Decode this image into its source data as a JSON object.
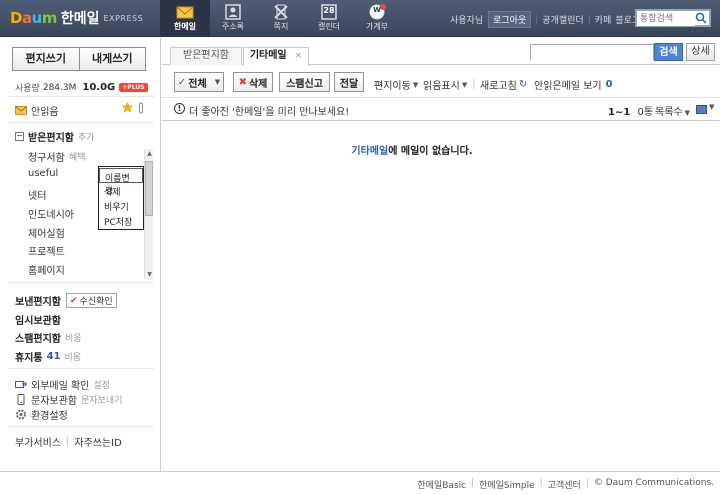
{
  "brand": {
    "logo_letters": [
      "D",
      "a",
      "u",
      "m"
    ],
    "service": "한메일",
    "edition": "EXPRESS"
  },
  "topnav": [
    {
      "label": "한메일",
      "icon": "mail-icon"
    },
    {
      "label": "주소록",
      "icon": "contacts-icon"
    },
    {
      "label": "쪽지",
      "icon": "note-icon"
    },
    {
      "label": "캘린더",
      "icon": "calendar-icon",
      "day": "28"
    },
    {
      "label": "가계부",
      "icon": "household-ledger-icon",
      "badge": "W"
    }
  ],
  "usermenu": {
    "user": "사용자님",
    "logout": "로그아웃",
    "links": [
      "공개캘린더",
      "카페",
      "블로그"
    ],
    "search_placeholder": "통합검색"
  },
  "sidebar": {
    "write": "편지쓰기",
    "write_self": "내게쓰기",
    "quota_label": "사용량",
    "quota_used": "284.3M",
    "quota_total": "10.0G",
    "quota_plus": "+PLUS",
    "unread": "안읽음",
    "inbox": {
      "label": "받은편지함",
      "extra": "추가"
    },
    "folders": [
      {
        "label": "청구서함",
        "sub": "혜택"
      },
      {
        "label": "useful"
      },
      {
        "label": "넷터"
      },
      {
        "label": "인도네시아"
      },
      {
        "label": "제어실험"
      },
      {
        "label": "프로젝트"
      },
      {
        "label": "홈페이지"
      }
    ],
    "context_menu": [
      "이름변경",
      "삭제",
      "비우기",
      "PC저장"
    ],
    "sent": {
      "label": "보낸편지함",
      "confirm": "수신확인"
    },
    "drafts": "임시보관함",
    "spam": {
      "label": "스팸편지함",
      "sub": "비움"
    },
    "trash": {
      "label": "휴지통",
      "count": "41",
      "sub": "비움"
    },
    "external": {
      "label": "외부메일 확인",
      "sub": "설정"
    },
    "sms": {
      "label": "문자보관함",
      "sub": "문자보내기"
    },
    "settings": "환경설정",
    "bottom_links": [
      "부가서비스",
      "자주쓰는ID"
    ]
  },
  "tabs": [
    {
      "label": "받은편지함"
    },
    {
      "label": "기타메일",
      "close": "×"
    }
  ],
  "mainsearch": {
    "button": "검색",
    "detail": "상세"
  },
  "toolbar": {
    "select_all": "전체",
    "delete": "삭제",
    "spam": "스팸신고",
    "forward": "전달",
    "move": "편지이동",
    "mark": "읽음표시",
    "refresh": "새로고침",
    "show_unread": "안읽은메일 보기",
    "unread_count": "0"
  },
  "infobar": {
    "message": "더 좋아진 '한메일'을 미리 만나보세요!",
    "range": "1~1",
    "total": "0통",
    "list_count": "목록수"
  },
  "empty": {
    "folder": "기타메일",
    "text": "에 메일이 없습니다."
  },
  "footer": [
    "한메일Basic",
    "한메일Simple",
    "고객센터",
    "© Daum Communications."
  ],
  "colors": {
    "topbar": "#3a4659",
    "accent_blue": "#2b5eb8",
    "search_button": "#4c84d6",
    "delete_red": "#e03c2c"
  }
}
